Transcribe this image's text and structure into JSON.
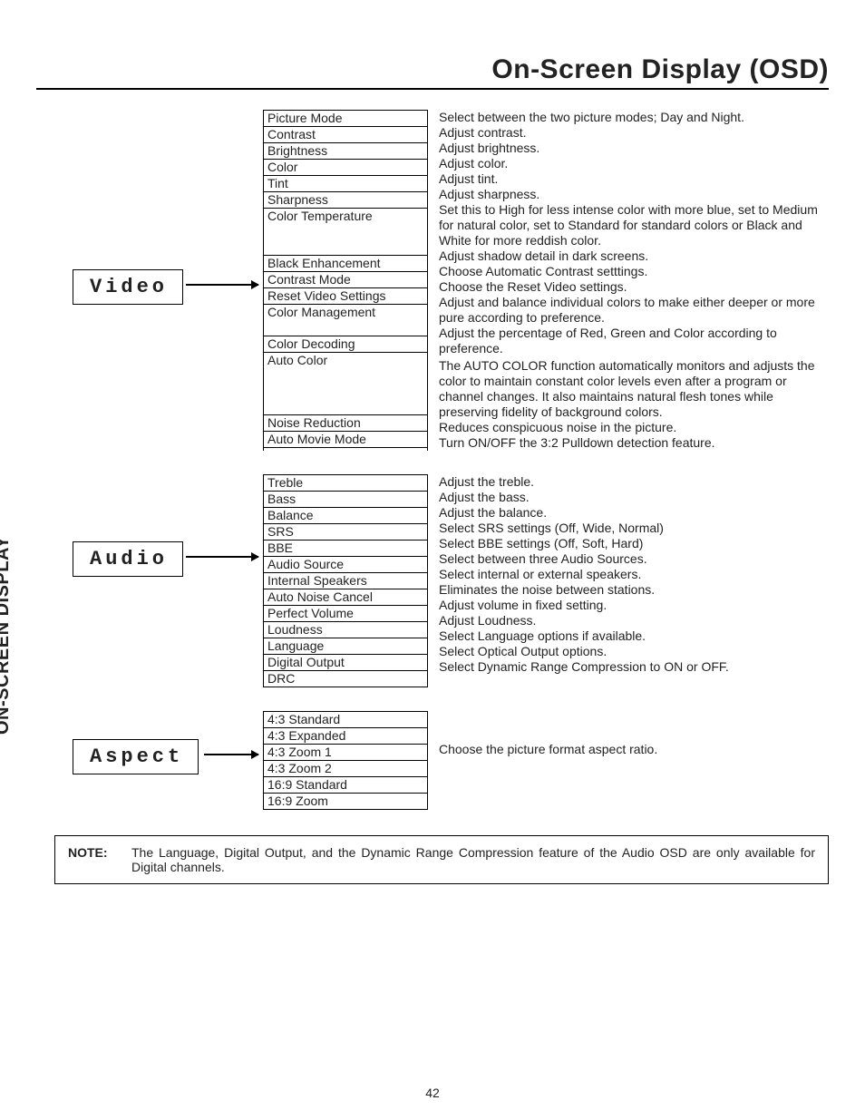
{
  "page_title": "On-Screen Display (OSD)",
  "side_label": "ON-SCREEN DISPLAY",
  "page_number": "42",
  "sections": {
    "video": {
      "label": "Video",
      "items": [
        "Picture Mode",
        "Contrast",
        "Brightness",
        "Color",
        "Tint",
        "Sharpness",
        "Color Temperature",
        "Black Enhancement",
        "Contrast Mode",
        "Reset Video Settings",
        "Color Management",
        "Color Decoding",
        "Auto Color",
        "Noise Reduction",
        "Auto Movie Mode"
      ],
      "descs": [
        "Select between the two picture modes; Day and Night.",
        "Adjust contrast.",
        "Adjust brightness.",
        "Adjust color.",
        "Adjust tint.",
        "Adjust sharpness.",
        "Set this to High for less intense color with more blue, set to Medium for natural color, set to Standard for standard colors or Black and White for more reddish color.",
        "Adjust shadow detail in dark screens.",
        "Choose Automatic Contrast setttings.",
        "Choose the Reset Video settings.",
        "Adjust and balance individual colors to make either deeper or more pure according to preference.",
        "Adjust the percentage of Red, Green and Color according to preference.",
        "The AUTO COLOR function automatically monitors and adjusts the color to maintain constant color levels even after a program or channel changes. It also maintains natural flesh tones while preserving fidelity of background colors.",
        "Reduces conspicuous noise in the picture.",
        "Turn ON/OFF the 3:2 Pulldown detection feature."
      ]
    },
    "audio": {
      "label": "Audio",
      "items": [
        "Treble",
        "Bass",
        "Balance",
        "SRS",
        "BBE",
        "Audio Source",
        "Internal Speakers",
        "Auto Noise Cancel",
        "Perfect Volume",
        "Loudness",
        "Language",
        "Digital Output",
        "DRC"
      ],
      "descs": [
        "Adjust the treble.",
        "Adjust the bass.",
        "Adjust the balance.",
        "Select SRS settings (Off, Wide, Normal)",
        "Select BBE settings (Off, Soft, Hard)",
        "Select between three Audio Sources.",
        "Select internal or external speakers.",
        "Eliminates the noise between stations.",
        "Adjust volume in fixed setting.",
        "Adjust Loudness.",
        "Select Language options if available.",
        "Select Optical Output options.",
        "Select Dynamic Range Compression to ON or OFF."
      ]
    },
    "aspect": {
      "label": "Aspect",
      "items": [
        "4:3 Standard",
        "4:3 Expanded",
        "4:3 Zoom 1",
        "4:3 Zoom 2",
        "16:9 Standard",
        "16:9 Zoom"
      ],
      "descs": [
        "",
        "",
        "Choose the picture format aspect ratio.",
        "",
        "",
        ""
      ]
    }
  },
  "note_label": "NOTE:",
  "note_text": "The Language, Digital Output, and the Dynamic Range Compression feature of the Audio OSD are only available for Digital channels."
}
